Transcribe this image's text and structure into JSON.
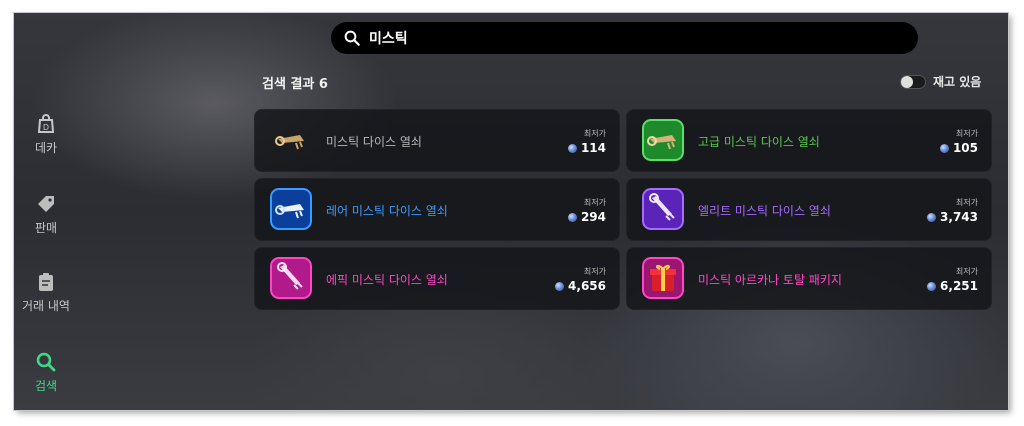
{
  "sidebar": {
    "items": [
      {
        "label": "데카",
        "icon": "shop-bag-icon",
        "active": false
      },
      {
        "label": "판매",
        "icon": "tag-icon",
        "active": false
      },
      {
        "label": "거래 내역",
        "icon": "clipboard-icon",
        "active": false
      },
      {
        "label": "검색",
        "icon": "search-icon",
        "active": true
      }
    ]
  },
  "search": {
    "value": "미스틱",
    "icon": "search-icon"
  },
  "results": {
    "title": "검색 결과 6"
  },
  "stock_toggle": {
    "label": "재고 있음",
    "on": false
  },
  "price_label": "최저가",
  "items": [
    {
      "name": "미스틱 다이스 열쇠",
      "price": "114",
      "color": "#b9b9b9",
      "icon": "key-icon",
      "frame": "none"
    },
    {
      "name": "고급 미스틱 다이스 열쇠",
      "price": "105",
      "color": "#58c84a",
      "icon": "key-icon",
      "frame": "green"
    },
    {
      "name": "레어 미스틱 다이스 열쇠",
      "price": "294",
      "color": "#3b9cff",
      "icon": "key-icon",
      "frame": "blue"
    },
    {
      "name": "엘리트 미스틱 다이스 열쇠",
      "price": "3,743",
      "color": "#a66bff",
      "icon": "key-icon",
      "frame": "purple"
    },
    {
      "name": "에픽 미스틱 다이스 열쇠",
      "price": "4,656",
      "color": "#ff46c8",
      "icon": "key-icon",
      "frame": "pink"
    },
    {
      "name": "미스틱 아르카나 토탈 패키지",
      "price": "6,251",
      "color": "#ff46c8",
      "icon": "gift-box-icon",
      "frame": "pink"
    }
  ],
  "colors": {
    "active": "#3ddc84",
    "card_bg": "#15161a",
    "search_bg": "#000000"
  }
}
